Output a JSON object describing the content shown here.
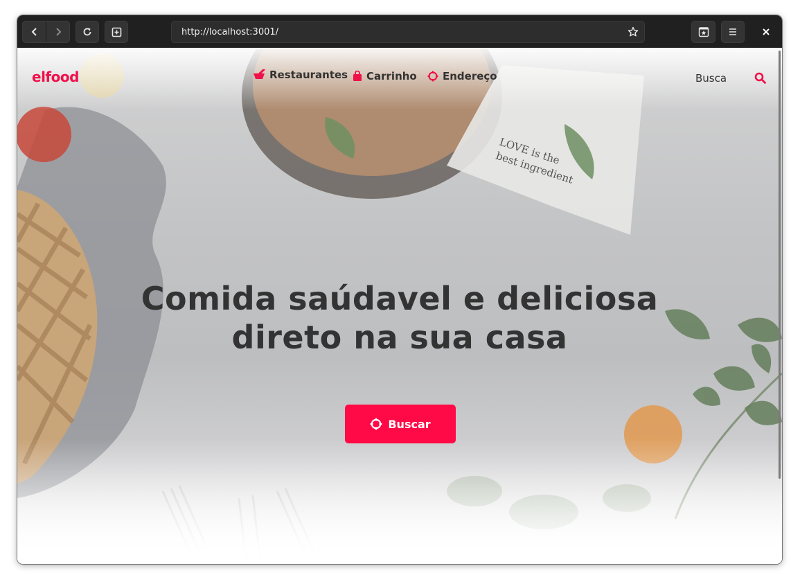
{
  "browser": {
    "url": "http://localhost:3001/"
  },
  "site": {
    "brand": "elfood",
    "nav": [
      {
        "label": "Restaurantes",
        "icon": "mortar-icon"
      },
      {
        "label": "Carrinho",
        "icon": "bag-icon"
      },
      {
        "label": "Endereço",
        "icon": "crosshair-icon"
      }
    ],
    "search_label": "Busca"
  },
  "hero": {
    "headline_line1": "Comida saúdavel e deliciosa",
    "headline_line2": "direto na sua casa",
    "cta_label": "Buscar",
    "napkin_text_line1": "LOVE is the",
    "napkin_text_line2": "best ingredient"
  },
  "colors": {
    "accent": "#ff0a46",
    "text": "#333333",
    "toolbar": "#202020"
  }
}
